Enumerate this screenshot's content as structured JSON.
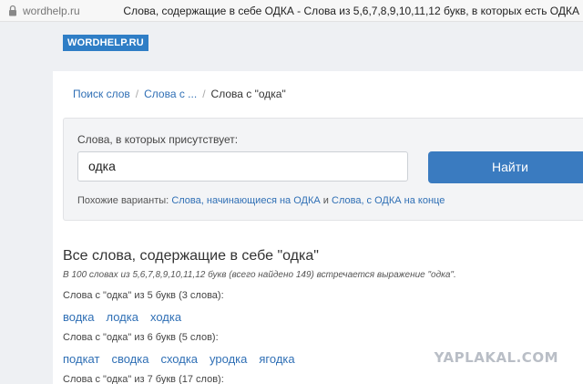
{
  "browser": {
    "url": "wordhelp.ru",
    "tab_title": "Слова, содержащие в себе ОДКА - Слова из 5,6,7,8,9,10,11,12 букв, в которых есть ОДКА"
  },
  "site": {
    "logo": "WORDHELP.RU"
  },
  "breadcrumb": {
    "items": [
      "Поиск слов",
      "Слова с ...",
      "Слова с \"одка\""
    ]
  },
  "search": {
    "label": "Слова, в которых присутствует:",
    "value": "одка",
    "button": "Найти",
    "similar_prefix": "Похожие варианты:",
    "similar_link_1": "Слова, начинающиеся на ОДКА",
    "similar_and": "и",
    "similar_link_2": "Слова, с ОДКА на конце"
  },
  "results": {
    "title": "Все слова, содержащие в себе \"одка\"",
    "description": "В 100 словах из 5,6,7,8,9,10,11,12 букв (всего найдено 149) встречается выражение \"одка\".",
    "groups": [
      {
        "heading": "Слова с \"одка\" из 5 букв (3 слова):",
        "words": [
          "водка",
          "лодка",
          "ходка"
        ]
      },
      {
        "heading": "Слова с \"одка\" из 6 букв (5 слов):",
        "words": [
          "подкат",
          "сводка",
          "сходка",
          "уродка",
          "ягодка"
        ]
      },
      {
        "heading": "Слова с \"одка\" из 7 букв (17 слов):",
        "words": []
      }
    ]
  },
  "watermark": "YAPLAKAL.COM",
  "colors": {
    "accent": "#3a7bc0",
    "link": "#2f6fb5",
    "logo_bg": "#2f7ec6"
  }
}
